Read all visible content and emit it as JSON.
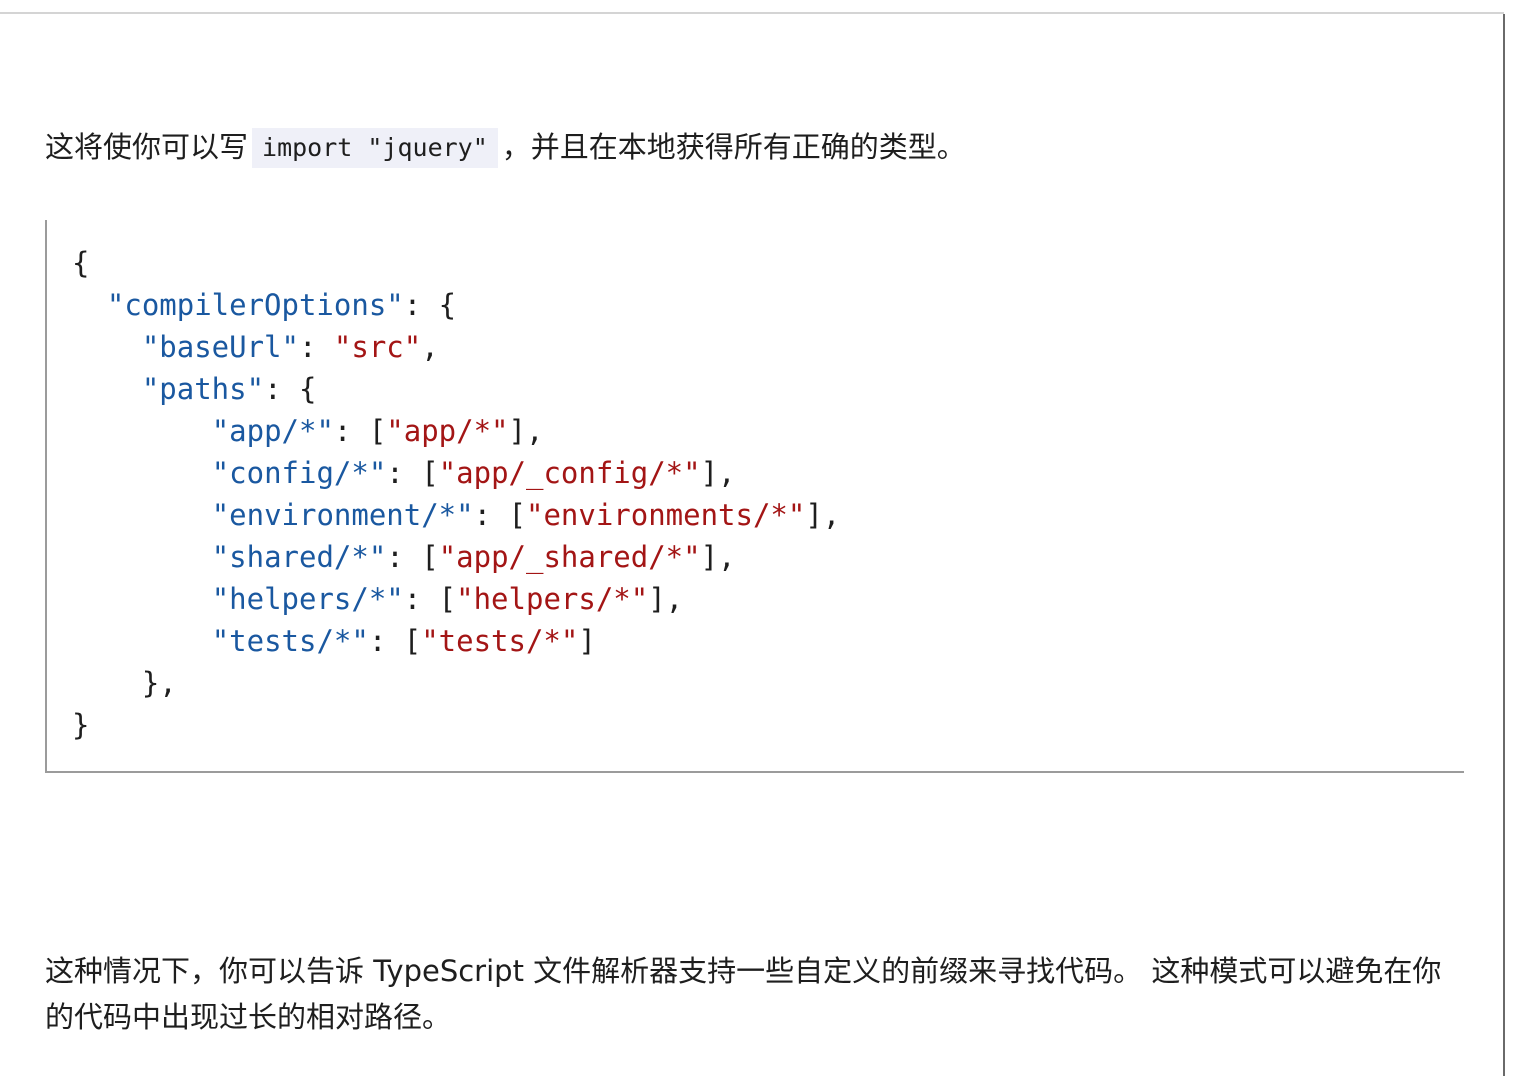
{
  "paragraph_1": {
    "before": "这将使你可以写",
    "code": "import \"jquery\"",
    "after": "，并且在本地获得所有正确的类型。"
  },
  "code_block": {
    "lines": [
      [
        {
          "t": "{",
          "k": "punc"
        }
      ],
      [
        {
          "t": "  ",
          "k": "punc"
        },
        {
          "t": "\"compilerOptions\"",
          "k": "key"
        },
        {
          "t": ": {",
          "k": "punc"
        }
      ],
      [
        {
          "t": "    ",
          "k": "punc"
        },
        {
          "t": "\"baseUrl\"",
          "k": "key"
        },
        {
          "t": ": ",
          "k": "punc"
        },
        {
          "t": "\"src\"",
          "k": "str"
        },
        {
          "t": ",",
          "k": "punc"
        }
      ],
      [
        {
          "t": "    ",
          "k": "punc"
        },
        {
          "t": "\"paths\"",
          "k": "key"
        },
        {
          "t": ": {",
          "k": "punc"
        }
      ],
      [
        {
          "t": "        ",
          "k": "punc"
        },
        {
          "t": "\"app/*\"",
          "k": "key"
        },
        {
          "t": ": [",
          "k": "punc"
        },
        {
          "t": "\"app/*\"",
          "k": "str"
        },
        {
          "t": "],",
          "k": "punc"
        }
      ],
      [
        {
          "t": "        ",
          "k": "punc"
        },
        {
          "t": "\"config/*\"",
          "k": "key"
        },
        {
          "t": ": [",
          "k": "punc"
        },
        {
          "t": "\"app/_config/*\"",
          "k": "str"
        },
        {
          "t": "],",
          "k": "punc"
        }
      ],
      [
        {
          "t": "        ",
          "k": "punc"
        },
        {
          "t": "\"environment/*\"",
          "k": "key"
        },
        {
          "t": ": [",
          "k": "punc"
        },
        {
          "t": "\"environments/*\"",
          "k": "str"
        },
        {
          "t": "],",
          "k": "punc"
        }
      ],
      [
        {
          "t": "        ",
          "k": "punc"
        },
        {
          "t": "\"shared/*\"",
          "k": "key"
        },
        {
          "t": ": [",
          "k": "punc"
        },
        {
          "t": "\"app/_shared/*\"",
          "k": "str"
        },
        {
          "t": "],",
          "k": "punc"
        }
      ],
      [
        {
          "t": "        ",
          "k": "punc"
        },
        {
          "t": "\"helpers/*\"",
          "k": "key"
        },
        {
          "t": ": [",
          "k": "punc"
        },
        {
          "t": "\"helpers/*\"",
          "k": "str"
        },
        {
          "t": "],",
          "k": "punc"
        }
      ],
      [
        {
          "t": "        ",
          "k": "punc"
        },
        {
          "t": "\"tests/*\"",
          "k": "key"
        },
        {
          "t": ": [",
          "k": "punc"
        },
        {
          "t": "\"tests/*\"",
          "k": "str"
        },
        {
          "t": "]",
          "k": "punc"
        }
      ],
      [
        {
          "t": "    },",
          "k": "punc"
        }
      ],
      [
        {
          "t": "}",
          "k": "punc"
        }
      ]
    ]
  },
  "paragraph_2": {
    "text": "这种情况下，你可以告诉 TypeScript 文件解析器支持一些自定义的前缀来寻找代码。 这种模式可以避免在你的代码中出现过长的相对路径。"
  },
  "colors": {
    "json_key": "#1a58a0",
    "json_string": "#a31515",
    "inline_code_bg": "#eff0f8"
  }
}
